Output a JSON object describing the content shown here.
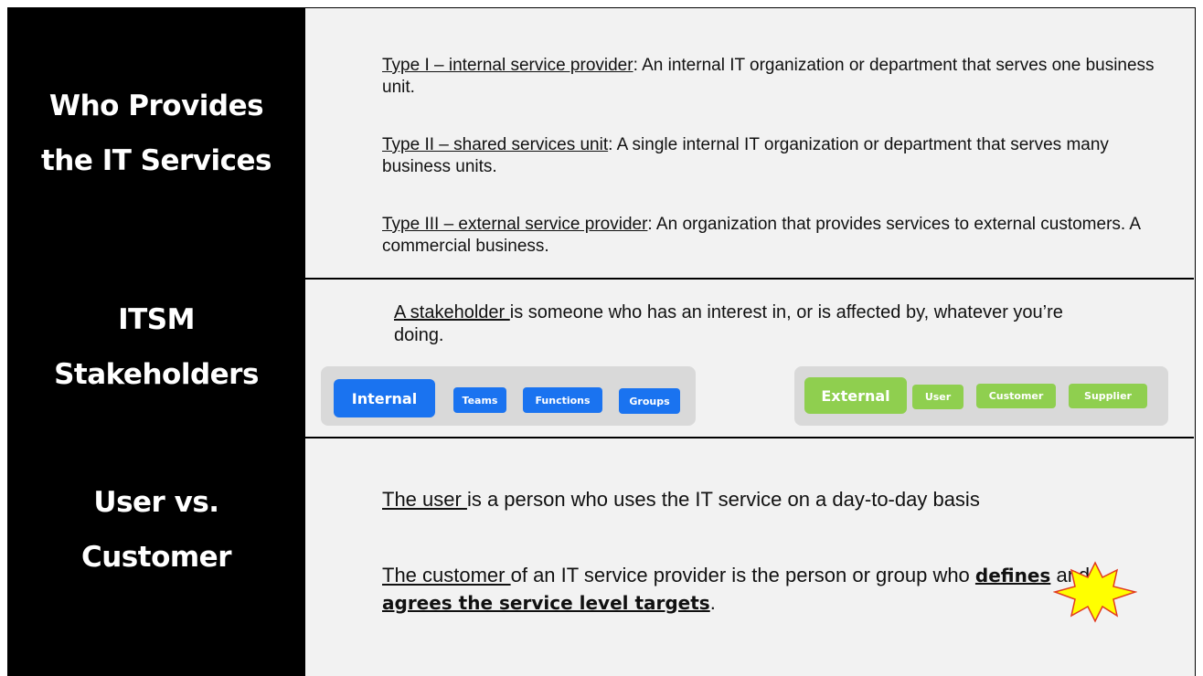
{
  "sidebar": {
    "section1": {
      "line1": "Who Provides",
      "line2": "the IT Services"
    },
    "section2": {
      "line1": "ITSM",
      "line2": "Stakeholders"
    },
    "section3": {
      "line1": "User vs.",
      "line2": "Customer"
    }
  },
  "providers": {
    "type1": {
      "term": "Type I – internal service provider",
      "text": ": An internal IT organization or department that serves one business unit."
    },
    "type2": {
      "term": "Type II – shared services unit",
      "text": ": A single internal IT organization or department that serves many business units."
    },
    "type3": {
      "term": "Type III – external service provider",
      "text": ": An organization that provides services to external customers. A commercial business."
    }
  },
  "stakeholders": {
    "term": "A stakeholder ",
    "text": "is someone who has an interest in, or is affected by, whatever you’re doing.",
    "internal": {
      "label": "Internal",
      "items": [
        "Teams",
        "Functions",
        "Groups"
      ],
      "color": "#1a73f0"
    },
    "external": {
      "label": "External",
      "items": [
        "User",
        "Customer",
        "Supplier"
      ],
      "color": "#8fcf4f"
    }
  },
  "user_vs_customer": {
    "user": {
      "term": "The user ",
      "text": "is a person who uses the IT service on a day-to-day basis"
    },
    "customer": {
      "term": "The customer ",
      "text1": "of an IT service provider is the person or group who ",
      "bold1": "defines",
      "text2": " and ",
      "bold2": "agrees the service level targets",
      "text3": "."
    }
  },
  "decoration": {
    "star_icon": "star-burst-icon",
    "star_fill": "#ffff00",
    "star_stroke": "#e23b1e"
  }
}
